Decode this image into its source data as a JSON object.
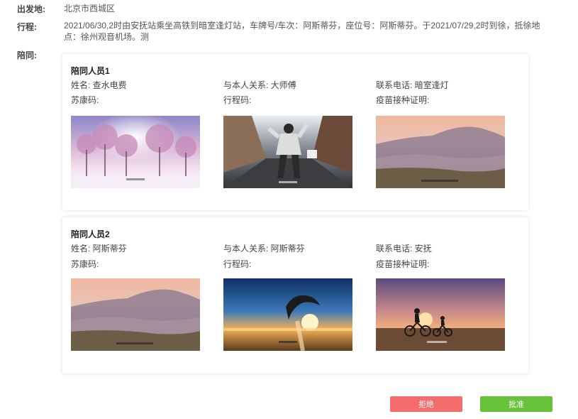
{
  "departure": {
    "label": "出发地:",
    "value": "北京市西城区"
  },
  "itinerary": {
    "label": "行程:",
    "value": "2021/06/30,2时由安抚站乘坐高铁到暗室逢灯站，车牌号/车次：阿斯蒂芬，座位号：阿斯蒂芬。于2021/07/29,2时到徐，抵徐地点：徐州观音机场。测"
  },
  "companions_label": "陪同:",
  "companions": [
    {
      "title": "陪同人员1",
      "name": "姓名: 查水电费",
      "relation": "与本人关系: 大师傅",
      "phone": "联系电话: 暗室逢灯",
      "code1": "苏康码:",
      "code2": "行程码:",
      "code3": "疫苗接种证明:",
      "photos": [
        "winter-trees-photo",
        "dancer-street-photo",
        "misty-hills-photo"
      ]
    },
    {
      "title": "陪同人员2",
      "name": "姓名: 阿斯蒂芬",
      "relation": "与本人关系: 阿斯蒂芬",
      "phone": "联系电话: 安抚",
      "code1": "苏康码:",
      "code2": "行程码:",
      "code3": "疫苗接种证明:",
      "photos": [
        "misty-hills-photo",
        "dolphin-sunset-photo",
        "cyclists-sunset-photo"
      ]
    }
  ],
  "buttons": {
    "reject": "拒绝",
    "approve": "批准",
    "reject_color": "#f56c6c",
    "approve_color": "#67c23a"
  }
}
